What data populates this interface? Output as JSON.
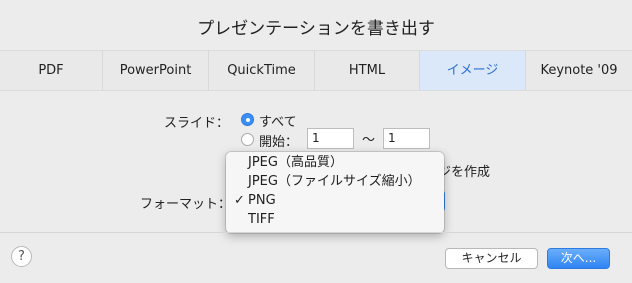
{
  "dialog": {
    "title": "プレゼンテーションを書き出す"
  },
  "tabs": [
    {
      "label": "PDF"
    },
    {
      "label": "PowerPoint"
    },
    {
      "label": "QuickTime"
    },
    {
      "label": "HTML"
    },
    {
      "label": "イメージ"
    },
    {
      "label": "Keynote '09"
    }
  ],
  "active_tab": "イメージ",
  "slides": {
    "label": "スライド：",
    "all_label": "すべて",
    "range_label": "開始：",
    "from_value": "1",
    "separator": "〜",
    "to_value": "1",
    "selected": "すべて"
  },
  "partial_option_text": "ジを作成",
  "format": {
    "label": "フォーマット：",
    "menu_items": [
      {
        "label": "JPEG（高品質）",
        "checked": false
      },
      {
        "label": "JPEG（ファイルサイズ縮小）",
        "checked": false
      },
      {
        "label": "PNG",
        "checked": true
      },
      {
        "label": "TIFF",
        "checked": false
      }
    ],
    "check_mark": "✓"
  },
  "footer": {
    "help_label": "?",
    "cancel_label": "キャンセル",
    "next_label": "次へ..."
  },
  "colors": {
    "accent": "#3a8ef6",
    "active_tab_bg": "#dbe8fa",
    "active_tab_text": "#2d6fd6"
  }
}
